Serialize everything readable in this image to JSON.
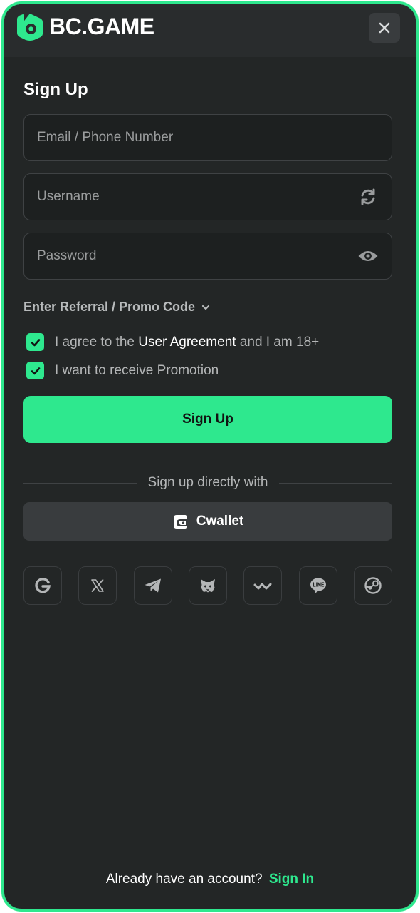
{
  "header": {
    "logo_text": "BC.GAME"
  },
  "form": {
    "title": "Sign Up",
    "email_placeholder": "Email / Phone Number",
    "username_placeholder": "Username",
    "password_placeholder": "Password",
    "referral_label": "Enter Referral / Promo Code",
    "agree_prefix": "I agree to the",
    "agree_link": "User Agreement",
    "agree_suffix": "and I am 18+",
    "promotion_label": "I want to receive Promotion",
    "submit_label": "Sign Up"
  },
  "social": {
    "divider_label": "Sign up directly with",
    "cwallet_label": "Cwallet",
    "providers": [
      "google-icon",
      "x-icon",
      "telegram-icon",
      "metamask-icon",
      "walletconnect-icon",
      "line-icon",
      "steam-icon"
    ]
  },
  "footer": {
    "prompt": "Already have an account?",
    "signin_label": "Sign In"
  },
  "colors": {
    "accent": "#2ee88e",
    "panel": "#232626",
    "field": "#1d2020"
  }
}
